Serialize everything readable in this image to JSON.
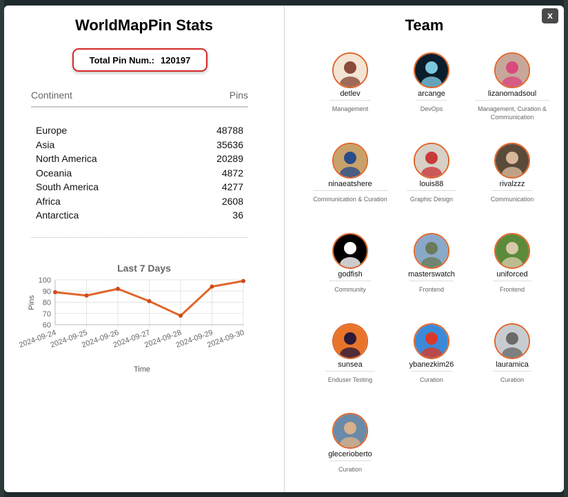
{
  "stats": {
    "title": "WorldMapPin Stats",
    "total_label": "Total Pin Num.:",
    "total_value": "120197",
    "col_continent": "Continent",
    "col_pins": "Pins",
    "rows": [
      {
        "name": "Europe",
        "pins": "48788"
      },
      {
        "name": "Asia",
        "pins": "35636"
      },
      {
        "name": "North America",
        "pins": "20289"
      },
      {
        "name": "Oceania",
        "pins": "4872"
      },
      {
        "name": "South America",
        "pins": "4277"
      },
      {
        "name": "Africa",
        "pins": "2608"
      },
      {
        "name": "Antarctica",
        "pins": "36"
      }
    ]
  },
  "chart_data": {
    "type": "line",
    "title": "Last 7 Days",
    "xlabel": "Time",
    "ylabel": "Pins",
    "x": [
      "2024-09-24",
      "2024-09-25",
      "2024-09-26",
      "2024-09-27",
      "2024-09-28",
      "2024-09-29",
      "2024-09-30"
    ],
    "values": [
      89,
      86,
      92,
      81,
      68,
      94,
      99
    ],
    "ylim": [
      60,
      100
    ],
    "yticks": [
      60,
      70,
      80,
      90,
      100
    ],
    "grid": true,
    "color": "#e0662a"
  },
  "team": {
    "title": "Team",
    "close_label": "x",
    "members": [
      {
        "name": "detlev",
        "role": "Management",
        "c1": "#f3e4d4",
        "c2": "#8a4b3a"
      },
      {
        "name": "arcange",
        "role": "DevOps",
        "c1": "#0b1d2a",
        "c2": "#7cc6e0"
      },
      {
        "name": "lizanomadsoul",
        "role": "Management, Curation & Communication",
        "c1": "#c7a79a",
        "c2": "#d84a7e"
      },
      {
        "name": "ninaeatshere",
        "role": "Communication & Curation",
        "c1": "#c8a16a",
        "c2": "#2a4c8a"
      },
      {
        "name": "louis88",
        "role": "Graphic Design",
        "c1": "#d6d0c6",
        "c2": "#c83a3a"
      },
      {
        "name": "rivalzzz",
        "role": "Communication",
        "c1": "#5a4a3a",
        "c2": "#d8b89a"
      },
      {
        "name": "godfish",
        "role": "Community",
        "c1": "#000000",
        "c2": "#ffffff"
      },
      {
        "name": "masterswatch",
        "role": "Frontend",
        "c1": "#8aa8c8",
        "c2": "#6a7a5a"
      },
      {
        "name": "uniforced",
        "role": "Frontend",
        "c1": "#5a8a3a",
        "c2": "#d6c8a8"
      },
      {
        "name": "sunsea",
        "role": "Enduser Testing",
        "c1": "#e8742a",
        "c2": "#2a1a3a"
      },
      {
        "name": "ybanezkim26",
        "role": "Curation",
        "c1": "#3a8ad8",
        "c2": "#d83a2a"
      },
      {
        "name": "lauramica",
        "role": "Curation",
        "c1": "#c8ccd0",
        "c2": "#6a6a6a"
      },
      {
        "name": "glecerioberto",
        "role": "Curation",
        "c1": "#6a8aa8",
        "c2": "#d8b08a"
      }
    ]
  }
}
